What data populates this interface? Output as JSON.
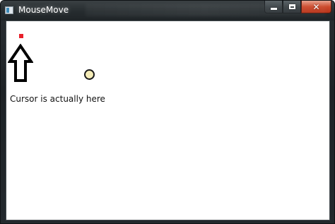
{
  "window": {
    "title": "MouseMove",
    "close_glyph": "✕"
  },
  "client": {
    "label_text": "Cursor is actually here"
  },
  "icons": {
    "app": "application-icon",
    "minimize": "minimize-icon",
    "maximize": "maximize-icon",
    "close": "close-icon",
    "arrow": "up-arrow-icon",
    "cursor_marker": "cursor-circle-marker",
    "red_marker": "red-dot-marker"
  },
  "colors": {
    "red_marker": "#e8202a",
    "circle_fill": "#f6edb8",
    "close_button": "#cc4a2c"
  }
}
